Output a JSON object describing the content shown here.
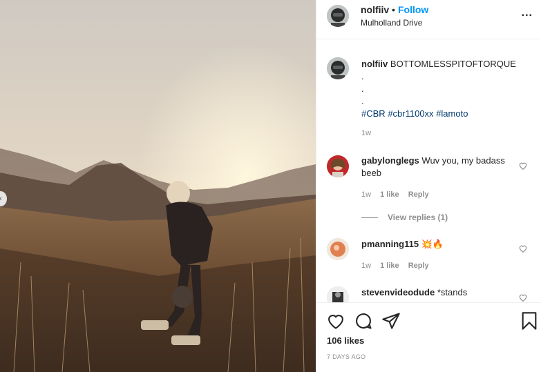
{
  "post": {
    "username": "nolfiiv",
    "dot": "•",
    "follow_label": "Follow",
    "location": "Mulholland Drive",
    "more": "..."
  },
  "caption": {
    "username": "nolfiiv",
    "text": "BOTTOMLESSPITOFTORQUE",
    "dots": [
      ".",
      ".",
      "."
    ],
    "hashtags": [
      "#CBR",
      "#cbr1100xx",
      "#lamoto"
    ],
    "time": "1w"
  },
  "comments": [
    {
      "username": "gabylonglegs",
      "text": "Wuv you, my badass beeb",
      "time": "1w",
      "likes": "1 like",
      "reply": "Reply"
    },
    {
      "username": "pmanning115",
      "text": "💥🔥",
      "time": "1w",
      "likes": "1 like",
      "reply": "Reply"
    },
    {
      "username": "stevenvideodude",
      "text": "*stands"
    }
  ],
  "view_replies": "View replies (1)",
  "likes_count": "106 likes",
  "posted_ago": "7 DAYS AGO",
  "icons": {
    "heart": "heart-icon",
    "comment": "comment-icon",
    "share": "share-icon",
    "save": "bookmark-icon",
    "carousel": "chevron-left-icon"
  },
  "colors": {
    "accent": "#0095f6",
    "hashtag": "#00376b",
    "muted": "#8e8e8e",
    "text": "#262626"
  }
}
